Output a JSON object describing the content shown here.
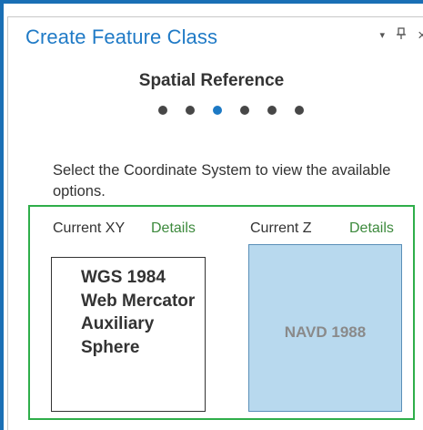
{
  "pane": {
    "title": "Create Feature Class",
    "controls": {
      "menu_glyph": "▾",
      "pin_glyph": "ᴘ",
      "close_glyph": "×"
    }
  },
  "wizard": {
    "step_heading": "Spatial Reference",
    "steps_total": 6,
    "current_step": 3
  },
  "instructions": "Select the Coordinate System to view the available options.",
  "current_xy": {
    "label": "Current XY",
    "details_label": "Details",
    "value": "WGS 1984 Web Mercator Auxiliary Sphere"
  },
  "current_z": {
    "label": "Current Z",
    "details_label": "Details",
    "value": "NAVD 1988"
  },
  "colors": {
    "accent": "#1f7ac6",
    "active_dot": "#1c79c4",
    "options_border": "#2fae4a",
    "details_link": "#3d8a3d",
    "z_tile_fill": "#b8d9ee"
  },
  "icons": {
    "menu": "chevron-down-icon",
    "pin": "pin-icon",
    "close": "close-icon"
  }
}
